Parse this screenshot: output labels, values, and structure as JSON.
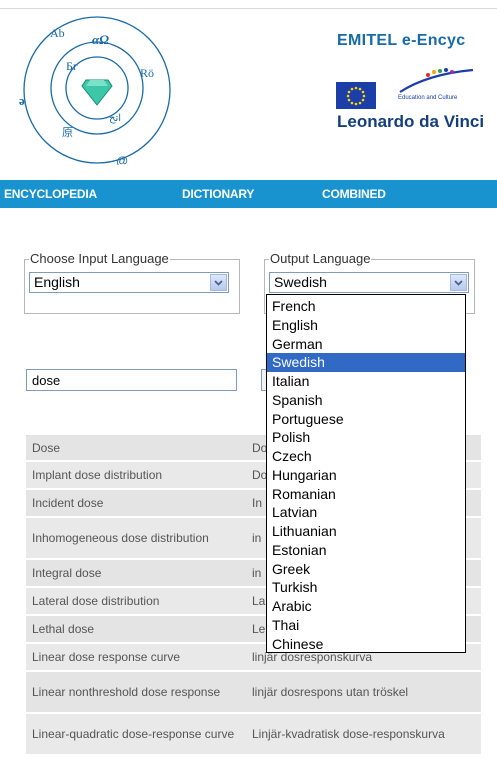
{
  "logo": {
    "glyphs": [
      "Ab",
      "αΩ",
      "Бг",
      "Rö",
      "ə",
      "ﺍﺗﺢ",
      "原",
      "@"
    ]
  },
  "header": {
    "site_title": "EMITEL e-Encyc",
    "ec_caption": "Education and Culture",
    "program": "Leonardo da Vinci"
  },
  "nav": [
    "ENCYCLOPEDIA",
    "DICTIONARY",
    "COMBINED"
  ],
  "input_language": {
    "legend": "Choose Input Language",
    "selected": "English"
  },
  "output_language": {
    "legend": "Output Language",
    "selected": "Swedish",
    "options": [
      "French",
      "English",
      "German",
      "Swedish",
      "Italian",
      "Spanish",
      "Portuguese",
      "Polish",
      "Czech",
      "Hungarian",
      "Romanian",
      "Latvian",
      "Lithuanian",
      "Estonian",
      "Greek",
      "Turkish",
      "Arabic",
      "Thai",
      "Chinese"
    ]
  },
  "search": {
    "value": "dose"
  },
  "results": [
    {
      "term": "Dose",
      "translation": "Do"
    },
    {
      "term": "Implant dose distribution",
      "translation": "Do"
    },
    {
      "term": "Incident dose",
      "translation": "In"
    },
    {
      "term": "Inhomogeneous dose distribution",
      "translation": "in"
    },
    {
      "term": "Integral dose",
      "translation": "in"
    },
    {
      "term": "Lateral dose distribution",
      "translation": "La"
    },
    {
      "term": "Lethal dose",
      "translation": "Le"
    },
    {
      "term": "Linear dose response curve",
      "translation": "linjär dosresponskurva"
    },
    {
      "term": "Linear nonthreshold dose response",
      "translation": "linjär dosrespons utan tröskel"
    },
    {
      "term": "Linear-quadratic dose-response curve",
      "translation": "Linjär-kvadratisk dose-responskurva"
    }
  ],
  "colors": {
    "nav_bg": "#1893d0",
    "title": "#1a6aa6",
    "selection": "#316ac5"
  }
}
